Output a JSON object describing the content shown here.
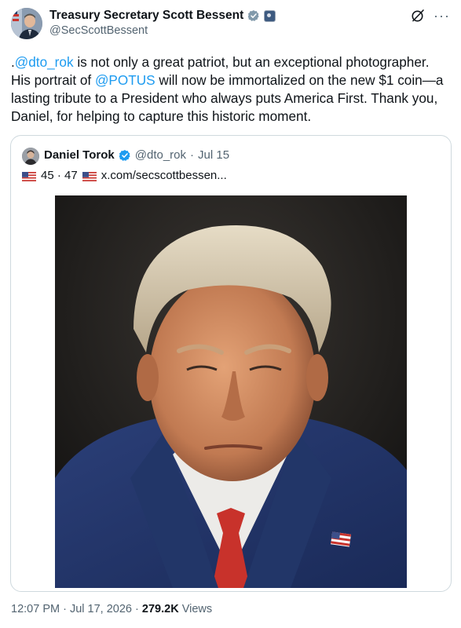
{
  "author": {
    "display_name": "Treasury Secretary Scott Bessent",
    "handle": "@SecScottBessent",
    "verified_icon": "verified-badge-icon",
    "affiliation_icon": "gov-badge-icon"
  },
  "actions": {
    "grok_icon": "grok-icon",
    "more_label": "···"
  },
  "tweet": {
    "text_lead": ".",
    "mention_1": "@dto_rok",
    "text_1": " is not only a great patriot, but an exceptional photographer. His portrait of ",
    "mention_2": "@POTUS",
    "text_2": " will now be immortalized on the new $1 coin—a lasting tribute to a President who always puts America First. Thank you, Daniel, for helping to capture this historic moment."
  },
  "quote": {
    "display_name": "Daniel Torok",
    "handle": "@dto_rok",
    "separator": "·",
    "date": "Jul 15",
    "text_mid": "45 · 47",
    "link": "x.com/secscottbessen...",
    "photo_icon": "portrait-photo"
  },
  "footer": {
    "time": "12:07 PM",
    "sep1": "·",
    "date": "Jul 17, 2026",
    "sep2": "·",
    "views_count": "279.2K",
    "views_label": "Views"
  },
  "colors": {
    "accent": "#1d9bf0",
    "text": "#0f1419",
    "secondary": "#536471",
    "border": "#cfd9de"
  }
}
